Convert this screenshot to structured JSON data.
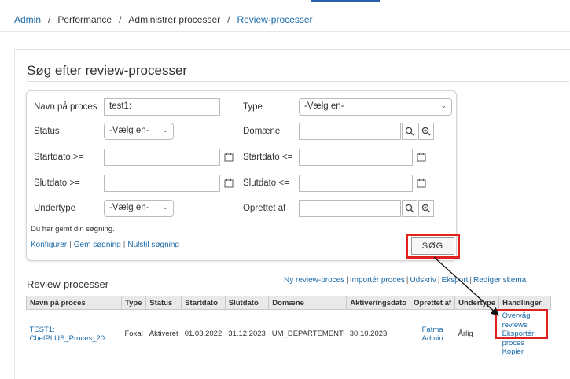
{
  "breadcrumb": {
    "items": [
      "Admin",
      "Performance",
      "Administrer processer",
      "Review-processer"
    ],
    "separator": "/"
  },
  "page": {
    "title": "Søg efter review-processer"
  },
  "search": {
    "name_label": "Navn på proces",
    "name_value": "test1:",
    "type_label": "Type",
    "type_value": "-Vælg en-",
    "status_label": "Status",
    "status_value": "-Vælg en-",
    "domain_label": "Domæne",
    "domain_value": "",
    "startdate_from_label": "Startdato >=",
    "startdate_to_label": "Startdato <=",
    "enddate_from_label": "Slutdato >=",
    "enddate_to_label": "Slutdato <=",
    "subtype_label": "Undertype",
    "subtype_value": "-Vælg en-",
    "created_by_label": "Oprettet af",
    "created_by_value": "",
    "saved_message": "Du har gemt din søgning.",
    "configure_link": "Konfigurer",
    "save_search_link": "Gem søgning",
    "reset_search_link": "Nulstil søgning",
    "search_button": "SØG"
  },
  "results": {
    "title": "Review-processer",
    "actions": [
      "Ny review-proces",
      "Importér proces",
      "Udskriv",
      "Eksport",
      "Rediger skema"
    ],
    "columns": [
      "Navn på proces",
      "Type",
      "Status",
      "Startdato",
      "Slutdato",
      "Domæne",
      "Aktiveringsdato",
      "Oprettet af",
      "Undertype",
      "Handlinger"
    ],
    "rows": [
      {
        "name_line1": "TEST1:",
        "name_line2": "ChefPLUS_Proces_20...",
        "type": "Fokal",
        "status": "Aktiveret",
        "start": "01.03.2022",
        "end": "31.12.2023",
        "domain": "UM_DEPARTEMENT",
        "activation": "30.10.2023",
        "created_by_line1": "Fatma",
        "created_by_line2": "Admin",
        "subtype": "Årlig",
        "actions": [
          "Overvåg reviews",
          "Eksportér proces",
          "Kopier"
        ]
      }
    ]
  },
  "colors": {
    "link": "#1a6aa8",
    "highlight": "#e0211f",
    "header_bg": "#e9e9e9"
  }
}
